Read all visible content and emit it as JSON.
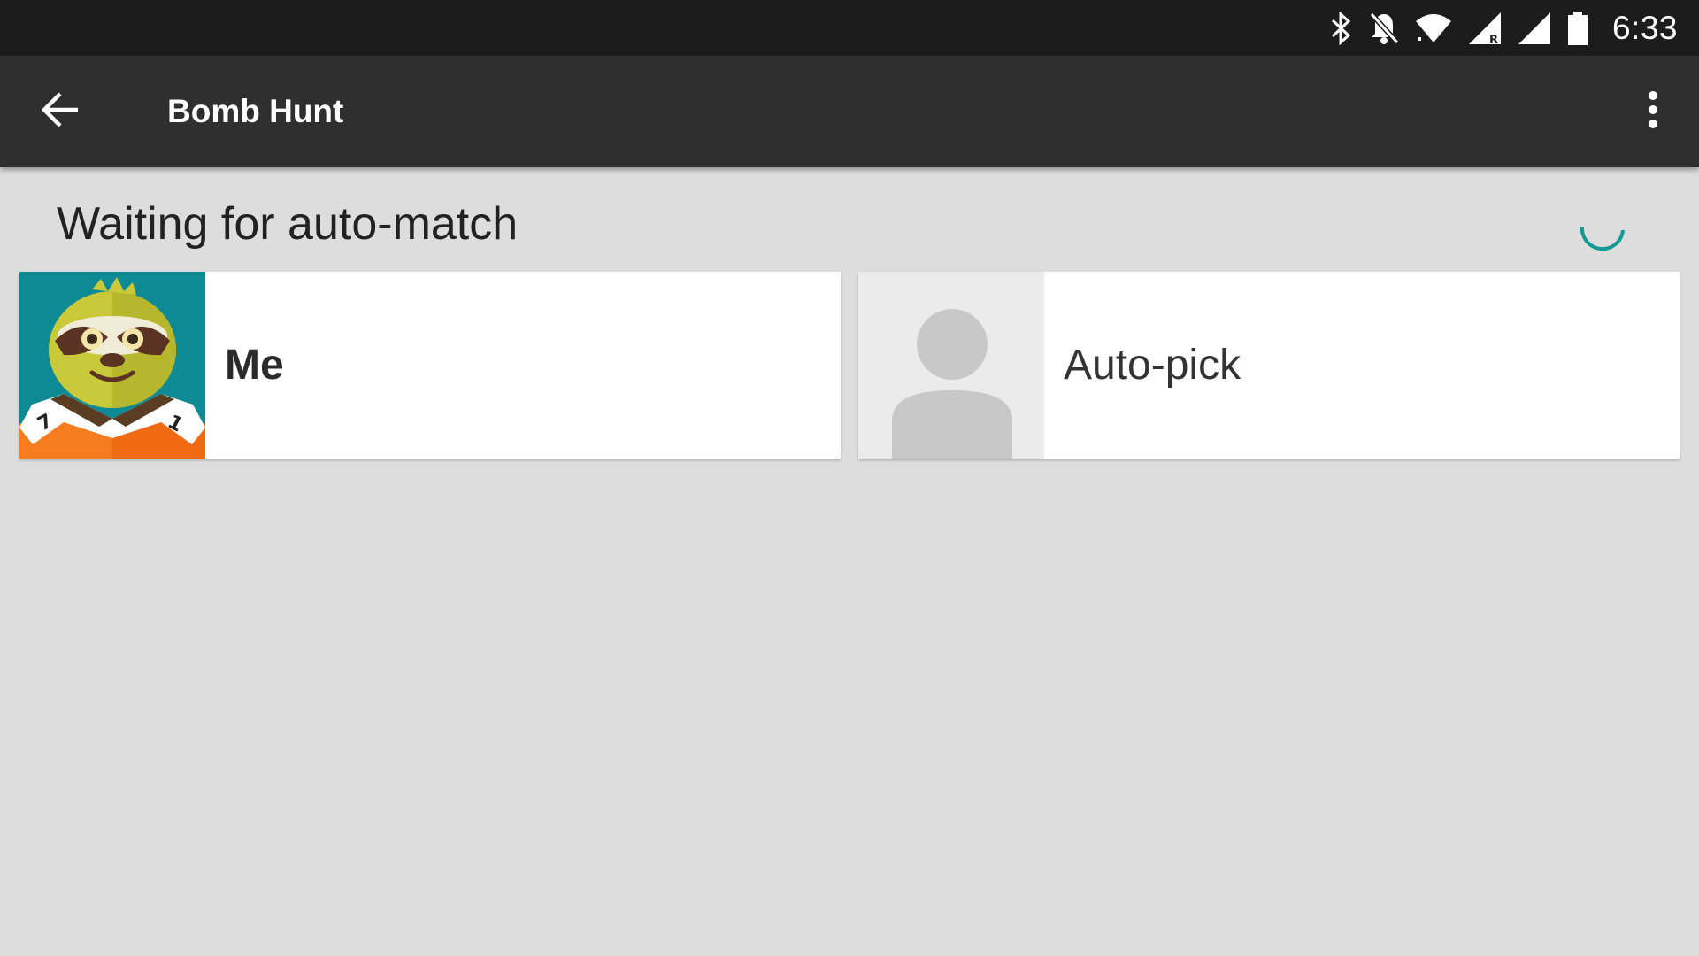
{
  "status_bar": {
    "time": "6:33",
    "icons": [
      "bluetooth-icon",
      "notifications-off-icon",
      "wifi-icon",
      "signal-roaming-icon",
      "signal-icon",
      "battery-icon"
    ]
  },
  "toolbar": {
    "title": "Bomb Hunt",
    "back_icon": "arrow-back-icon",
    "overflow_icon": "more-vertical-icon"
  },
  "main": {
    "heading": "Waiting for auto-match",
    "spinner_color": "#139a94",
    "players": [
      {
        "label": "Me",
        "avatar": "sloth-avatar"
      },
      {
        "label": "Auto-pick",
        "avatar": "person-placeholder-icon"
      }
    ]
  },
  "colors": {
    "status_bar": "#1c1c1c",
    "toolbar": "#2f2f2f",
    "background": "#dddddd",
    "card": "#ffffff",
    "accent": "#139a94"
  }
}
